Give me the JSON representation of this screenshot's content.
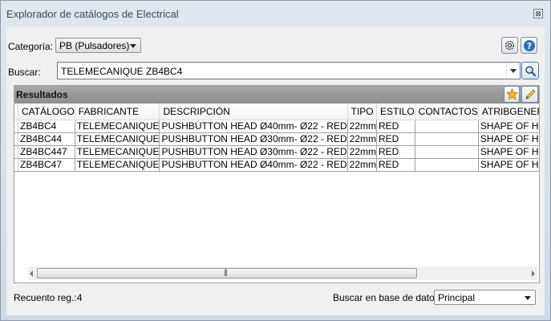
{
  "window": {
    "title": "Explorador de catálogos de Electrical",
    "close_glyph": "⊠"
  },
  "filters": {
    "category_label": "Categoría:",
    "category_value": "PB (Pulsadores)",
    "search_label": "Buscar:",
    "search_value": "TELEMECANIQUE ZB4BC4"
  },
  "results": {
    "header": "Resultados",
    "columns": [
      "CATÁLOGO",
      "FABRICANTE",
      "DESCRIPCIÓN",
      "TIPO",
      "ESTILO",
      "CONTACTOS",
      "ATRIBGENERZ"
    ],
    "rows": [
      [
        "ZB4BC4",
        "TELEMECANIQUE",
        "PUSHBUTTON HEAD Ø40mm- Ø22 - RED",
        "22mm",
        "RED",
        "",
        "SHAPE OF HEA"
      ],
      [
        "ZB4BC44",
        "TELEMECANIQUE",
        "PUSHBUTTON HEAD Ø30mm- Ø22 - RED",
        "22mm",
        "RED",
        "",
        "SHAPE OF HEA"
      ],
      [
        "ZB4BC447",
        "TELEMECANIQUE",
        "PUSHBUTTON HEAD Ø30mm- Ø22 - RED",
        "22mm",
        "RED",
        "",
        "SHAPE OF HEA"
      ],
      [
        "ZB4BC47",
        "TELEMECANIQUE",
        "PUSHBUTTON HEAD Ø40mm- Ø22 - RED",
        "22mm",
        "RED",
        "",
        "SHAPE OF HEA"
      ]
    ]
  },
  "footer": {
    "record_count": "Recuento reg.:4",
    "db_label": "Buscar en base de datos:",
    "db_value": "Principal"
  },
  "icons": {
    "settings": "gear-icon",
    "help": "help-icon",
    "search": "magnifier-icon",
    "favorite": "star-icon",
    "edit": "pencil-icon"
  },
  "colors": {
    "accent": "#2b6fb8",
    "star": "#f2b81d"
  }
}
